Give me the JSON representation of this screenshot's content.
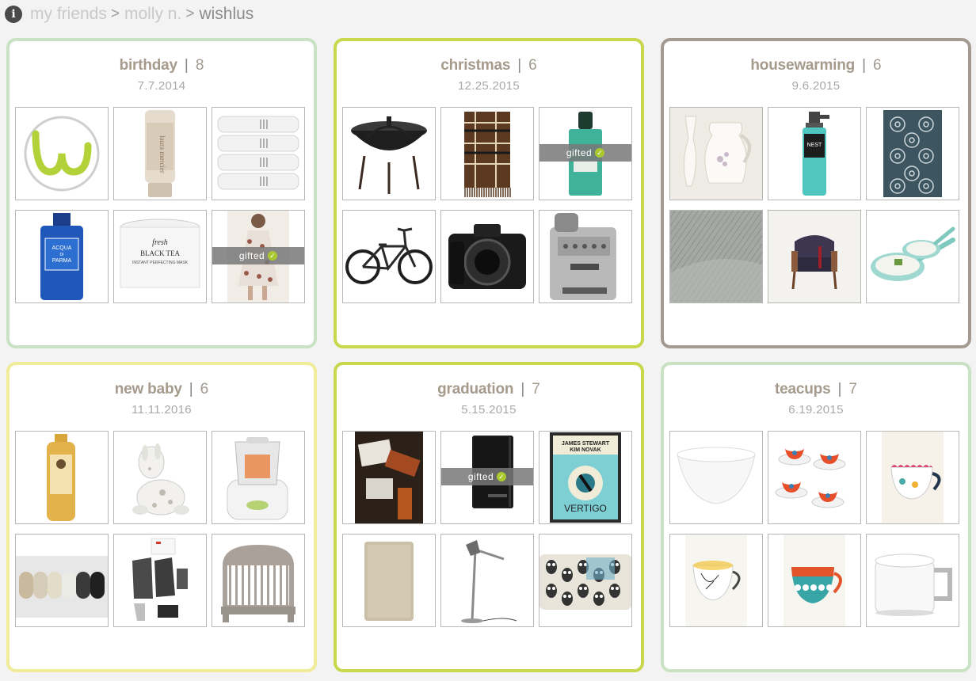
{
  "breadcrumb": {
    "items": [
      "my friends",
      "molly n.",
      "wishlus"
    ],
    "separator": ">"
  },
  "info_icon": "i",
  "gifted_label": "gifted",
  "cards": [
    {
      "name": "birthday",
      "count": "8",
      "date": "7.7.2014",
      "border_color": "#c8e2c3",
      "items": [
        {
          "icon": "logo-w-icon"
        },
        {
          "icon": "cosmetic-tube-icon"
        },
        {
          "icon": "towels-icon"
        },
        {
          "icon": "cologne-bottle-icon"
        },
        {
          "icon": "face-mask-jar-icon"
        },
        {
          "icon": "dress-icon",
          "gifted": true
        }
      ]
    },
    {
      "name": "christmas",
      "count": "6",
      "date": "12.25.2015",
      "border_color": "#c9d74d",
      "items": [
        {
          "icon": "fire-pit-icon"
        },
        {
          "icon": "plaid-scarf-icon"
        },
        {
          "icon": "perfume-bottle-icon",
          "gifted": true
        },
        {
          "icon": "bmx-bike-icon"
        },
        {
          "icon": "dslr-camera-icon"
        },
        {
          "icon": "espresso-machine-icon"
        }
      ]
    },
    {
      "name": "housewarming",
      "count": "6",
      "date": "9.6.2015",
      "border_color": "#a39a90",
      "items": [
        {
          "icon": "vases-icon"
        },
        {
          "icon": "soap-dispenser-icon"
        },
        {
          "icon": "floral-rug-icon"
        },
        {
          "icon": "throw-blanket-icon"
        },
        {
          "icon": "armchair-icon"
        },
        {
          "icon": "frying-pans-icon"
        }
      ]
    },
    {
      "name": "new baby",
      "count": "6",
      "date": "11.11.2016",
      "border_color": "#f0ec9a",
      "items": [
        {
          "icon": "baby-wash-bottle-icon"
        },
        {
          "icon": "plush-giraffe-icon"
        },
        {
          "icon": "baby-food-maker-icon"
        },
        {
          "icon": "swaddle-blankets-icon"
        },
        {
          "icon": "robe-set-icon"
        },
        {
          "icon": "crib-icon"
        }
      ]
    },
    {
      "name": "graduation",
      "count": "7",
      "date": "5.15.2015",
      "border_color": "#c9d74d",
      "items": [
        {
          "icon": "luggage-tags-icon"
        },
        {
          "icon": "notebook-icon",
          "gifted": true
        },
        {
          "icon": "vertigo-poster-icon"
        },
        {
          "icon": "bath-mat-icon"
        },
        {
          "icon": "floor-lamp-icon"
        },
        {
          "icon": "laptop-sleeve-icon"
        }
      ]
    },
    {
      "name": "teacups",
      "count": "7",
      "date": "6.19.2015",
      "border_color": "#c8e2c3",
      "items": [
        {
          "icon": "white-bowl-icon"
        },
        {
          "icon": "teacup-set-icon"
        },
        {
          "icon": "scalloped-teacup-icon"
        },
        {
          "icon": "painted-teacup-icon"
        },
        {
          "icon": "floral-teacup-icon"
        },
        {
          "icon": "white-mug-icon"
        }
      ]
    }
  ]
}
